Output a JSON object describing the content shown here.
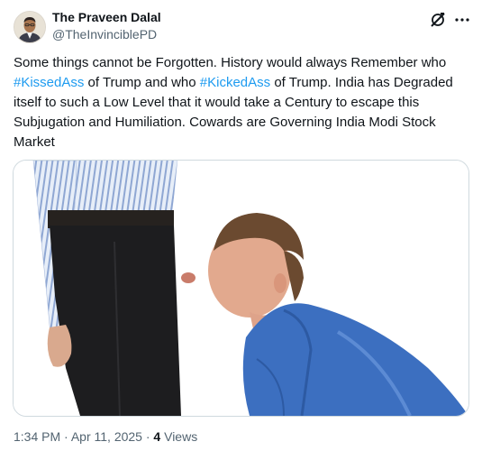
{
  "author": {
    "name": "The Praveen Dalal",
    "handle": "@TheInvinciblePD",
    "avatar": "profile-photo"
  },
  "header_icons": [
    "grok-icon",
    "more-icon"
  ],
  "tweet": {
    "segments": [
      {
        "type": "text",
        "value": "Some things cannot be Forgotten. History would always Remember who "
      },
      {
        "type": "hashtag",
        "value": "#KissedAss"
      },
      {
        "type": "text",
        "value": " of Trump and who "
      },
      {
        "type": "hashtag",
        "value": "#KickedAss"
      },
      {
        "type": "text",
        "value": " of Trump. India has Degraded itself to such a Low Level that it would take a Century to escape this Subjugation and Humiliation. Cowards are Governing India Modi Stock Market"
      }
    ]
  },
  "media": {
    "type": "photo"
  },
  "meta": {
    "time": "1:34 PM",
    "date": "Apr 11, 2025",
    "separator": "·",
    "views_count": "4",
    "views_label": "Views"
  },
  "colors": {
    "text": "#0f1419",
    "secondary": "#536471",
    "link": "#1d9bf0",
    "border": "#cfd9de"
  }
}
